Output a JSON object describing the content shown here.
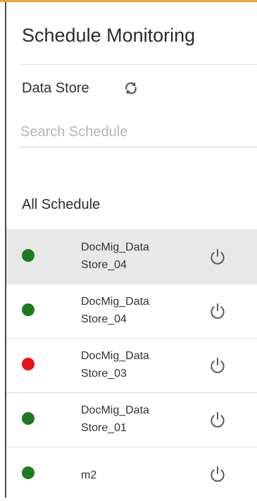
{
  "panel": {
    "title": "Schedule Monitoring",
    "data_store_label": "Data Store",
    "refresh_icon": "refresh-icon",
    "search_placeholder": "Search Schedule",
    "section_title": "All Schedule"
  },
  "schedules": [
    {
      "name": "DocMig_Data Store_04",
      "status_color": "#1e7a1e",
      "selected": true
    },
    {
      "name": "DocMig_Data Store_04",
      "status_color": "#1e7a1e",
      "selected": false
    },
    {
      "name": "DocMig_Data Store_03",
      "status_color": "#ee1111",
      "selected": false
    },
    {
      "name": "DocMig_Data Store_01",
      "status_color": "#1e7a1e",
      "selected": false
    },
    {
      "name": "m2",
      "status_color": "#1e7a1e",
      "selected": false
    }
  ],
  "colors": {
    "accent_border": "#f0a030",
    "status_ok": "#1e7a1e",
    "status_error": "#ee1111"
  }
}
